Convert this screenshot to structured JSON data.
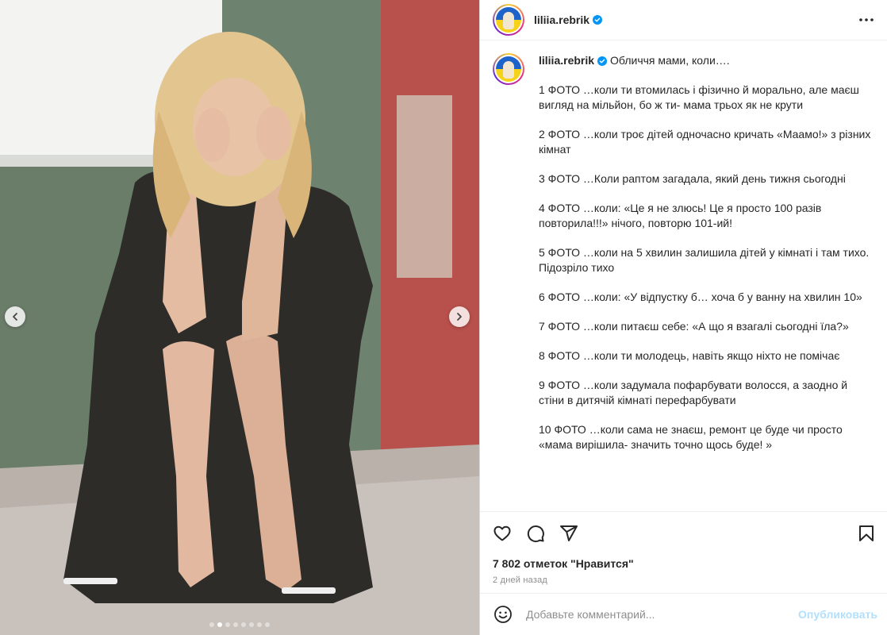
{
  "post": {
    "username": "liliia.rebrik",
    "more_icon": "more-horizontal-icon",
    "verified_icon": "verified-badge-icon"
  },
  "media": {
    "carousel_total": 8,
    "carousel_active": 1,
    "prev_icon": "chevron-left-icon",
    "next_icon": "chevron-right-icon"
  },
  "caption": {
    "title": "Обличчя мами, коли….",
    "paragraphs": [
      "1 ФОТО …коли ти втомилась і фізично й морально, але маєш вигляд на мільйон, бо ж ти- мама трьох як не крути",
      "2 ФОТО …коли троє дітей одночасно кричать «Маамо!» з різних кімнат",
      "3 ФОТО …Коли раптом загадала, який день тижня сьогодні",
      "4 ФОТО …коли: «Це я не злюсь! Це я просто 100 разів повторила!!!» нічого, повторю 101-ий!",
      "5 ФОТО …коли на 5 хвилин залишила дітей у кімнаті і там тихо.\nПідозріло тихо",
      "6 ФОТО …коли: «У відпустку б… хоча б у ванну  на хвилин 10»",
      "7 ФОТО …коли питаєш себе: «А що я взагалі сьогодні їла?»",
      "8 ФОТО …коли ти молодець, навіть якщо ніхто не помічає",
      "9 ФОТО …коли задумала пофарбувати волосся, а заодно й стіни в дитячій кімнаті перефарбувати",
      "10 ФОТО …коли сама не знаєш, ремонт це буде чи просто «мама вирішила- значить точно щось буде!  »"
    ]
  },
  "actions": {
    "like_icon": "heart-icon",
    "comment_icon": "comment-icon",
    "share_icon": "send-icon",
    "save_icon": "bookmark-icon"
  },
  "likes_text": "7 802 отметок \"Нравится\"",
  "date_text": "2 дней назад",
  "comment": {
    "emoji_icon": "emoji-smile-icon",
    "placeholder": "Добавьте комментарий...",
    "publish_label": "Опубликовать"
  },
  "colors": {
    "publish_disabled": "#b2dffc",
    "verified": "#0095f6",
    "muted_text": "#8e8e8e"
  }
}
